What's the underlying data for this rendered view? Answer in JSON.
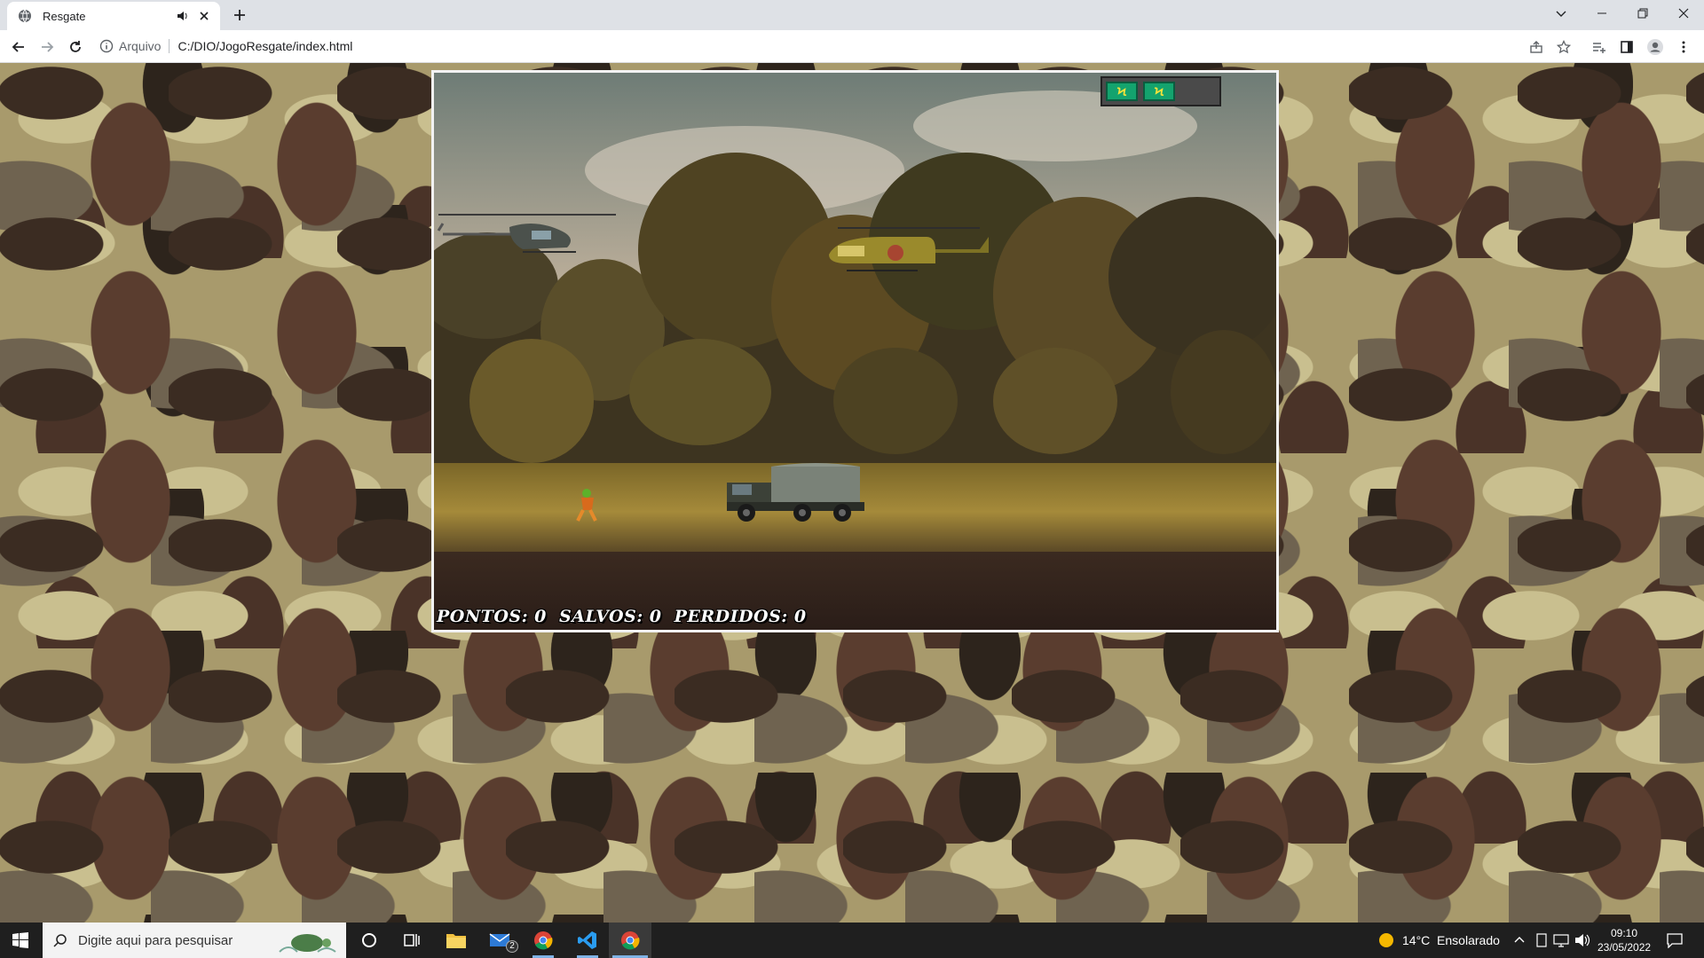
{
  "browser": {
    "tab_title": "Resgate",
    "url_scheme": "Arquivo",
    "url": "C:/DIO/JogoResgate/index.html"
  },
  "game": {
    "energy_cells": 2,
    "energy_symbol": "Ϟ",
    "score": {
      "pontos_label": "PONTOS:",
      "pontos_value": "0",
      "salvos_label": "SALVOS:",
      "salvos_value": "0",
      "perdidos_label": "PERDIDOS:",
      "perdidos_value": "0"
    }
  },
  "taskbar": {
    "search_placeholder": "Digite aqui para pesquisar",
    "mail_badge": "2",
    "weather": "14°C  Ensolarado",
    "time": "09:10",
    "date": "23/05/2022"
  },
  "colors": {
    "energy_cell": "#14a36e",
    "camo_base": "#a89a6c"
  }
}
